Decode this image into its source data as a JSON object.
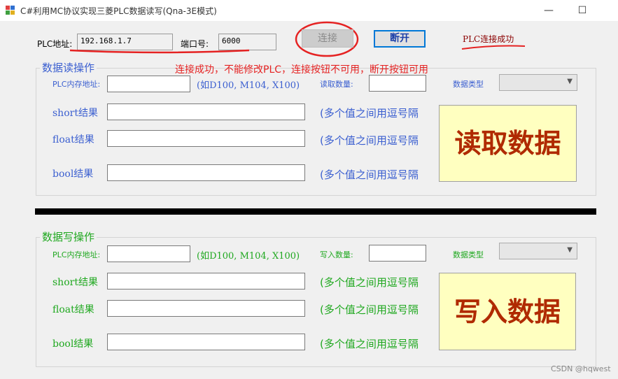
{
  "window": {
    "title": "C#利用MC协议实现三菱PLC数据读写(Qna-3E模式)",
    "minimize_glyph": "—",
    "maximize_glyph": "☐",
    "icon": "app-window-icon"
  },
  "connection": {
    "plc_address_label": "PLC地址:",
    "plc_address_value": "192.168.1.7",
    "port_label": "端口号:",
    "port_value": "6000",
    "connect_label": "连接",
    "disconnect_label": "断开",
    "status_text": "PLC连接成功",
    "annotation": "连接成功，不能修改PLC，连接按钮不可用，断开按钮可用"
  },
  "read_group": {
    "legend": "数据读操作",
    "mem_addr_label": "PLC内存地址:",
    "mem_addr_value": "",
    "mem_addr_hint": "(如D100, M104, X100)",
    "count_label": "读取数量:",
    "count_value": "",
    "type_label": "数据类型",
    "type_value": "",
    "short_label": "short结果",
    "float_label": "float结果",
    "bool_label": "bool结果",
    "short_hint": "(多个值之间用逗号隔",
    "float_hint": "(多个值之间用逗号隔",
    "bool_hint": "(多个值之间用逗号隔",
    "action_label": "读取数据"
  },
  "write_group": {
    "legend": "数据写操作",
    "mem_addr_label": "PLC内存地址:",
    "mem_addr_value": "",
    "mem_addr_hint": "(如D100, M104, X100)",
    "count_label": "写入数量:",
    "count_value": "",
    "type_label": "数据类型",
    "type_value": "",
    "short_label": "short结果",
    "float_label": "float结果",
    "bool_label": "bool结果",
    "short_hint": "(多个值之间用逗号隔",
    "float_hint": "(多个值之间用逗号隔",
    "bool_hint": "(多个值之间用逗号隔",
    "action_label": "写入数据"
  },
  "watermark": "CSDN @hqwest",
  "colors": {
    "annotation_red": "#e52222",
    "read_label_blue": "#3b5fd0",
    "write_label_green": "#1fa81f",
    "action_button_bg": "#ffffc0",
    "action_button_text": "#b02a00",
    "disconnect_border": "#0078d7"
  }
}
